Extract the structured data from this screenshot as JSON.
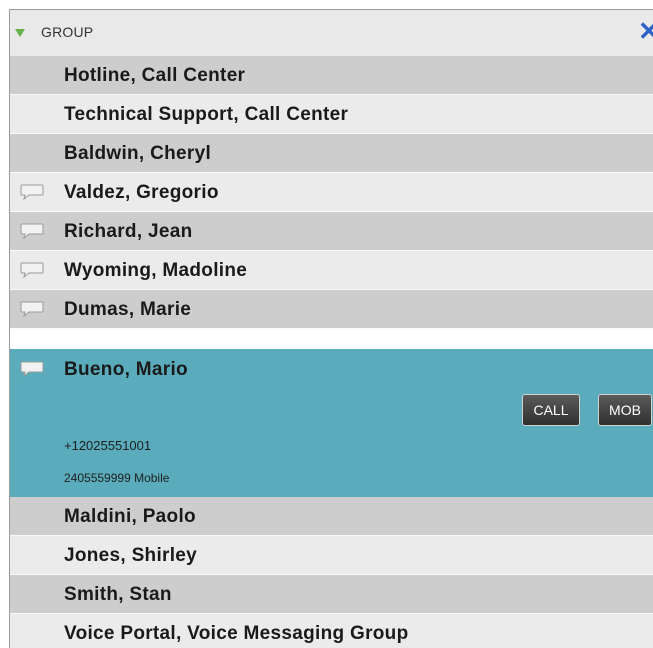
{
  "group": {
    "title": "GROUP",
    "expand_icon": "triangle-down-icon",
    "close_icon": "close-x-icon"
  },
  "contacts_before": [
    {
      "name": "Hotline, Call Center",
      "has_chat_icon": false
    },
    {
      "name": "Technical Support, Call Center",
      "has_chat_icon": false
    },
    {
      "name": "Baldwin, Cheryl",
      "has_chat_icon": false
    },
    {
      "name": "Valdez, Gregorio",
      "has_chat_icon": true
    },
    {
      "name": "Richard, Jean",
      "has_chat_icon": true
    },
    {
      "name": "Wyoming, Madoline",
      "has_chat_icon": true
    },
    {
      "name": "Dumas, Marie",
      "has_chat_icon": true
    }
  ],
  "selected_contact": {
    "name": "Bueno, Mario",
    "call_label": "CALL",
    "mob_label": "MOB",
    "phone": "+12025551001",
    "mobile": "2405559999 Mobile"
  },
  "contacts_after": [
    {
      "name": "Maldini, Paolo",
      "has_chat_icon": false
    },
    {
      "name": "Jones, Shirley",
      "has_chat_icon": false
    },
    {
      "name": "Smith, Stan",
      "has_chat_icon": false
    },
    {
      "name": "Voice Portal, Voice Messaging Group",
      "has_chat_icon": false
    }
  ],
  "colors": {
    "row_dark": "#cdcdcd",
    "row_light": "#ebebeb",
    "selected": "#5aacbc",
    "close_icon": "#2f63c7",
    "expand_icon": "#69b24a"
  }
}
